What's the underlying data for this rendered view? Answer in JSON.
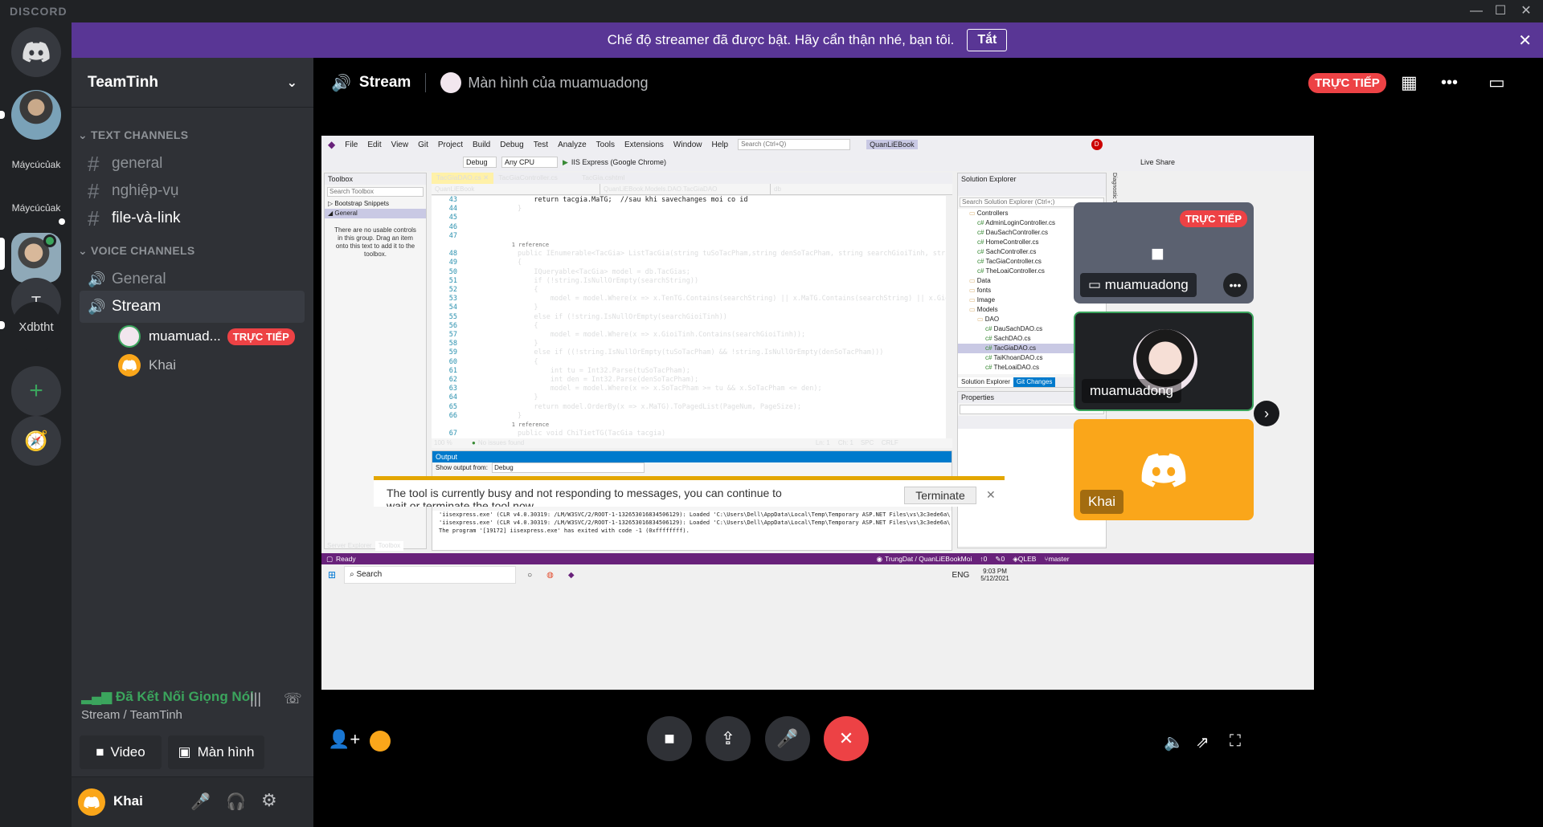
{
  "app": {
    "brand": "DISCORD"
  },
  "banner": {
    "text": "Chế độ streamer đã được bật. Hãy cẩn thận nhé, bạn tôi.",
    "button": "Tắt"
  },
  "guilds": {
    "items": [
      {
        "label": "Máycúcủak"
      },
      {
        "label": "Máycúcủak"
      },
      {
        "label": "T"
      },
      {
        "label": "Xdbtht"
      }
    ]
  },
  "server": {
    "name": "TeamTinh"
  },
  "text_category": "TEXT CHANNELS",
  "text_channels": [
    "general",
    "nghiệp-vụ",
    "file-và-link"
  ],
  "voice_category": "VOICE CHANNELS",
  "voice_channels": [
    "General",
    "Stream"
  ],
  "voice_users": [
    {
      "name": "muamuad...",
      "badge": "TRỰC TIẾP"
    },
    {
      "name": "Khai"
    }
  ],
  "voice_panel": {
    "status": "Đã Kết Nối Giọng Nói",
    "location": "Stream / TeamTinh",
    "video_label": "Video",
    "screen_label": "Màn hình"
  },
  "user": {
    "name": "Khai"
  },
  "topbar": {
    "channel": "Stream",
    "stream_title": "Màn hình của muamuadong",
    "live": "TRỰC TIẾP"
  },
  "vs": {
    "menu": [
      "File",
      "Edit",
      "View",
      "Git",
      "Project",
      "Build",
      "Debug",
      "Test",
      "Analyze",
      "Tools",
      "Extensions",
      "Window",
      "Help"
    ],
    "search": "Search (Ctrl+Q)",
    "project": "QuanLiEBook",
    "config": "Debug",
    "platform": "Any CPU",
    "run": "IIS Express (Google Chrome)",
    "live_share": "Live Share",
    "tabs": [
      "TacGiaDAO.cs",
      "TacGiaController.cs",
      "TacGia.cshtml"
    ],
    "toolbox_title": "Toolbox",
    "toolbox_search": "Search Toolbox",
    "toolbox_groups": [
      "Bootstrap Snippets",
      "General"
    ],
    "toolbox_msg": "There are no usable controls in this group. Drag an item onto this text to add it to the toolbox.",
    "nav_left": "QuanLiEBook",
    "nav_mid": "QuanLiEBook.Models.DAO.TacGiaDAO",
    "nav_right": "db",
    "code_lines": [
      {
        "n": "43",
        "t": "            return tacgia.MaTG;  //sau khi savechanges moi co id"
      },
      {
        "n": "44",
        "t": "        }"
      },
      {
        "n": "45",
        "t": ""
      },
      {
        "n": "46",
        "t": ""
      },
      {
        "n": "47",
        "t": ""
      },
      {
        "n": "",
        "t": "        1 reference"
      },
      {
        "n": "48",
        "t": "        public IEnumerable<TacGia> ListTacGia(string tuSoTacPham,string denSoTacPham, string searchGioiTinh, string searchString,"
      },
      {
        "n": "49",
        "t": "        {"
      },
      {
        "n": "50",
        "t": "            IQueryable<TacGia> model = db.TacGias;"
      },
      {
        "n": "51",
        "t": "            if (!string.IsNullOrEmpty(searchString))"
      },
      {
        "n": "52",
        "t": "            {"
      },
      {
        "n": "53",
        "t": "                model = model.Where(x => x.TenTG.Contains(searchString) || x.MaTG.Contains(searchString) || x.GioiTinh.Contains(s"
      },
      {
        "n": "54",
        "t": "            }"
      },
      {
        "n": "55",
        "t": "            else if (!string.IsNullOrEmpty(searchGioiTinh))"
      },
      {
        "n": "56",
        "t": "            {"
      },
      {
        "n": "57",
        "t": "                model = model.Where(x => x.GioiTinh.Contains(searchGioiTinh));"
      },
      {
        "n": "58",
        "t": "            }"
      },
      {
        "n": "59",
        "t": "            else if ((!string.IsNullOrEmpty(tuSoTacPham) && !string.IsNullOrEmpty(denSoTacPham)))"
      },
      {
        "n": "60",
        "t": "            {"
      },
      {
        "n": "61",
        "t": "                int tu = Int32.Parse(tuSoTacPham);"
      },
      {
        "n": "62",
        "t": "                int den = Int32.Parse(denSoTacPham);"
      },
      {
        "n": "63",
        "t": "                model = model.Where(x => x.SoTacPham >= tu && x.SoTacPham <= den);"
      },
      {
        "n": "64",
        "t": "            }"
      },
      {
        "n": "65",
        "t": "            return model.OrderBy(x => x.MaTG).ToPagedList(PageNum, PageSize);"
      },
      {
        "n": "66",
        "t": "        }"
      },
      {
        "n": "",
        "t": "        1 reference"
      },
      {
        "n": "67",
        "t": "        public void ChiTietTG(TacGia tacgia)"
      }
    ],
    "zoom": "100 %",
    "issues": "No issues found",
    "ln": "Ln: 1",
    "ch": "Ch: 1",
    "spc": "SPC",
    "crlf": "CRLF",
    "output_title": "Output",
    "output_from_label": "Show output from:",
    "output_from": "Debug",
    "output_lines": [
      "'iisexpress.exe' (CLR v4.0.30319: /LM/W3SVC/2/ROOT-1-132653016834506129): Loaded 'C:\\Users\\Dell\\AppData\\Local\\Temp\\Temporary ASP.NET Files\\vs\\3c3ede6a\\",
      "'iisexpress.exe' (CLR v4.0.30319: /LM/W3SVC/2/ROOT-1-132653016834506129): Loaded 'C:\\Users\\Dell\\AppData\\Local\\Temp\\Temporary ASP.NET Files\\vs\\3c3ede6a\\",
      "The program '[19172] iisexpress.exe' has exited with code -1 (0xffffffff)."
    ],
    "busy_msg": "The tool is currently busy and not responding to messages, you can continue to wait or terminate the tool now.",
    "busy_btn": "Terminate",
    "solution_title": "Solution Explorer",
    "solution_search": "Search Solution Explorer (Ctrl+;)",
    "solution_items": [
      "Controllers",
      "AdminLoginController.cs",
      "DauSachController.cs",
      "HomeController.cs",
      "SachController.cs",
      "TacGiaController.cs",
      "TheLoaiController.cs",
      "Data",
      "fonts",
      "Image",
      "Models",
      "DAO",
      "DauSachDAO.cs",
      "SachDAO.cs",
      "TacGiaDAO.cs",
      "TaiKhoanDAO.cs",
      "TheLoaiDAO.cs"
    ],
    "solution_tabs": [
      "Solution Explorer",
      "Git Changes"
    ],
    "properties_title": "Properties",
    "bottom_tabs": [
      "Server Explorer",
      "Toolbox"
    ],
    "status_ready": "Ready",
    "status_repo": "TrungDat / QuanLiEBookMoi",
    "status_up": "0",
    "status_edits": "0",
    "status_branch_repo": "QLEB",
    "status_branch": "master",
    "side_tab": "Diagnostic Tools"
  },
  "taskbar": {
    "search": "Search",
    "time": "9:03 PM",
    "date": "5/12/2021",
    "lang": "ENG"
  },
  "tiles": [
    {
      "name": "muamuadong",
      "badge": "TRỰC TIẾP"
    },
    {
      "name": "muamuadong"
    },
    {
      "name": "Khai"
    }
  ],
  "colors": {
    "blurple": "#5865f2",
    "live_red": "#ed4245",
    "green": "#3ba55d",
    "orange": "#faa61a",
    "banner": "#593695"
  }
}
